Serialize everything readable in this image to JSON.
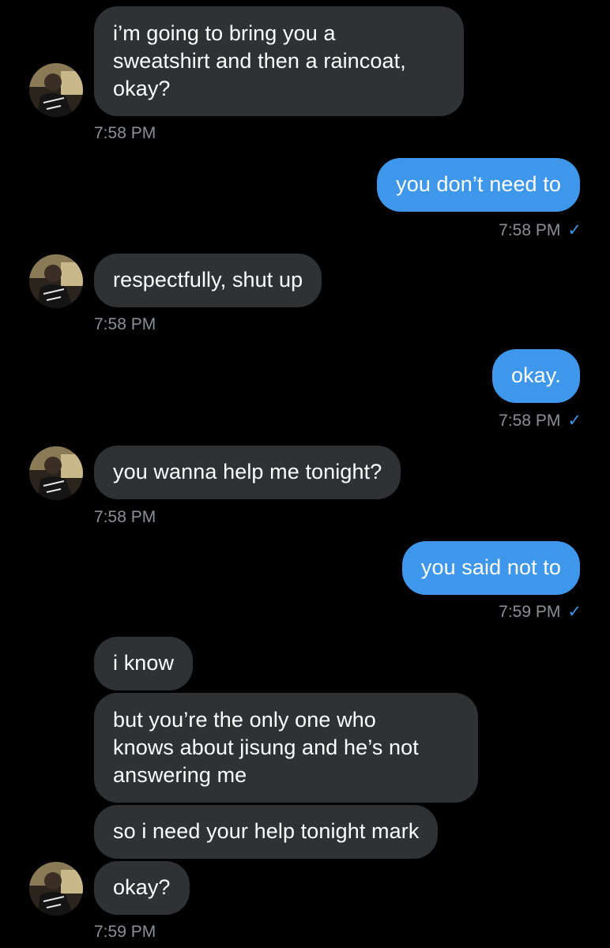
{
  "conversation": {
    "colors": {
      "background": "#000000",
      "incoming_bubble": "#2f3133",
      "outgoing_bubble": "#3e97ea",
      "timestamp": "#8c8f93",
      "read_check": "#3e97ea"
    },
    "read_receipt_icon": "checkmark-icon",
    "messages": [
      {
        "text": "i’m going to bring you a\nsweatshirt and then a raincoat,\nokay?",
        "time": "7:58 PM"
      },
      {
        "text": "you don’t need to",
        "time": "7:58 PM",
        "check": "✓"
      },
      {
        "text": "respectfully, shut up",
        "time": "7:58 PM"
      },
      {
        "text": "okay.",
        "time": "7:58 PM",
        "check": "✓"
      },
      {
        "text": "you wanna help me tonight?",
        "time": "7:58 PM"
      },
      {
        "text": "you said not to",
        "time": "7:59 PM",
        "check": "✓"
      },
      {
        "text": "i know"
      },
      {
        "text": "but you’re the only one who\nknows about jisung and he’s not\nanswering me"
      },
      {
        "text": "so i need your help tonight mark"
      },
      {
        "text": "okay?",
        "time": "7:59 PM"
      }
    ]
  }
}
